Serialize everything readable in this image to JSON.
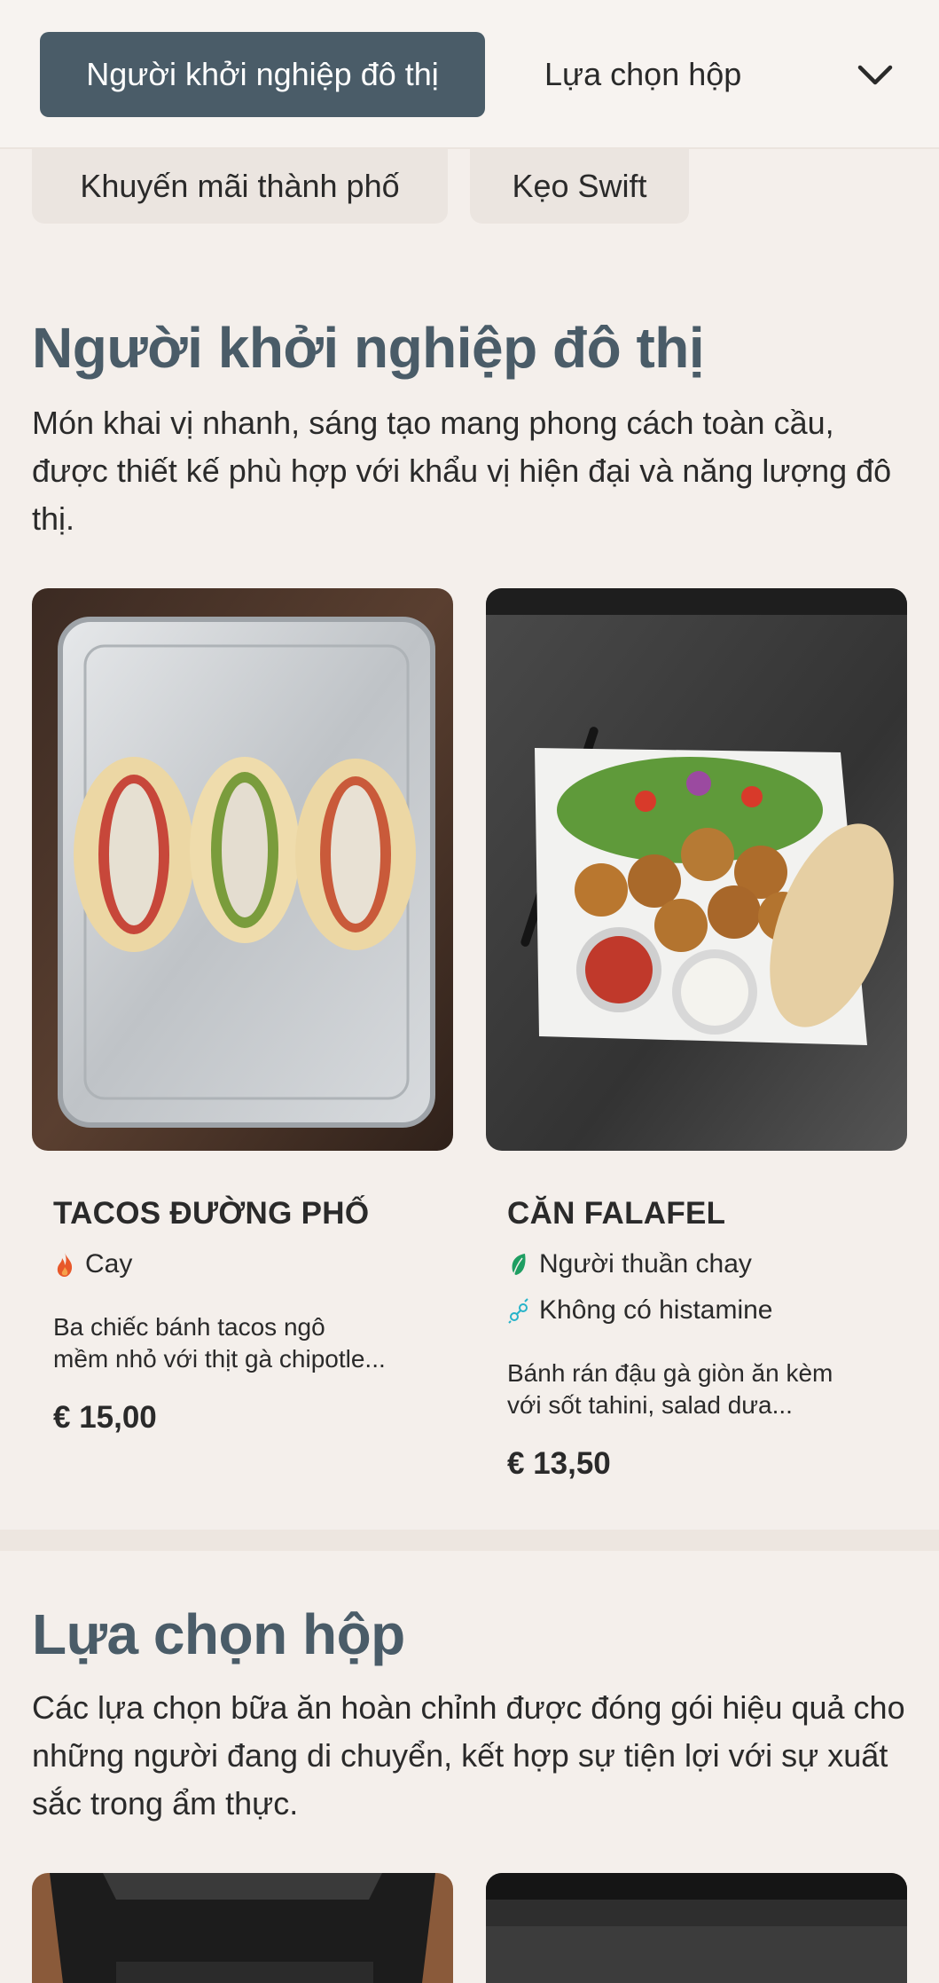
{
  "nav": {
    "active_tab": "Người khởi nghiệp đô thị",
    "tab2": "Lựa chọn hộp",
    "chevron_icon": "chevron-down-icon"
  },
  "subtabs": [
    "Khuyến mãi thành phố",
    "Kẹo Swift"
  ],
  "section1": {
    "title": "Người khởi nghiệp đô thị",
    "description": "Món khai vị nhanh, sáng tạo mang phong cách toàn cầu, được thiết kế phù hợp với khẩu vị hiện đại và năng lượng đô thị.",
    "items": [
      {
        "name": "TACOS ĐƯỜNG PHỐ",
        "tags": [
          {
            "icon": "flame-icon",
            "label": "Cay",
            "color": "#e8582a"
          }
        ],
        "description_line1": "Ba chiếc bánh tacos ngô",
        "description_line2": "mềm nhỏ với thịt gà chipotle...",
        "price": "€ 15,00"
      },
      {
        "name": "CĂN FALAFEL",
        "tags": [
          {
            "icon": "leaf-icon",
            "label": "Người thuần chay",
            "color": "#1e9e62"
          },
          {
            "icon": "histamine-free-icon",
            "label": "Không có histamine",
            "color": "#27b3c9"
          }
        ],
        "description_line1": "Bánh rán đậu gà giòn ăn kèm",
        "description_line2": "với sốt tahini, salad dưa...",
        "price": "€ 13,50"
      }
    ]
  },
  "section2": {
    "title": "Lựa chọn hộp",
    "description": "Các lựa chọn bữa ăn hoàn chỉnh được đóng gói hiệu quả cho những người đang di chuyển, kết hợp sự tiện lợi với sự xuất sắc trong ẩm thực."
  },
  "colors": {
    "background": "#f4efeb",
    "accent": "#4a5c68",
    "chip": "#ebe5e0"
  }
}
